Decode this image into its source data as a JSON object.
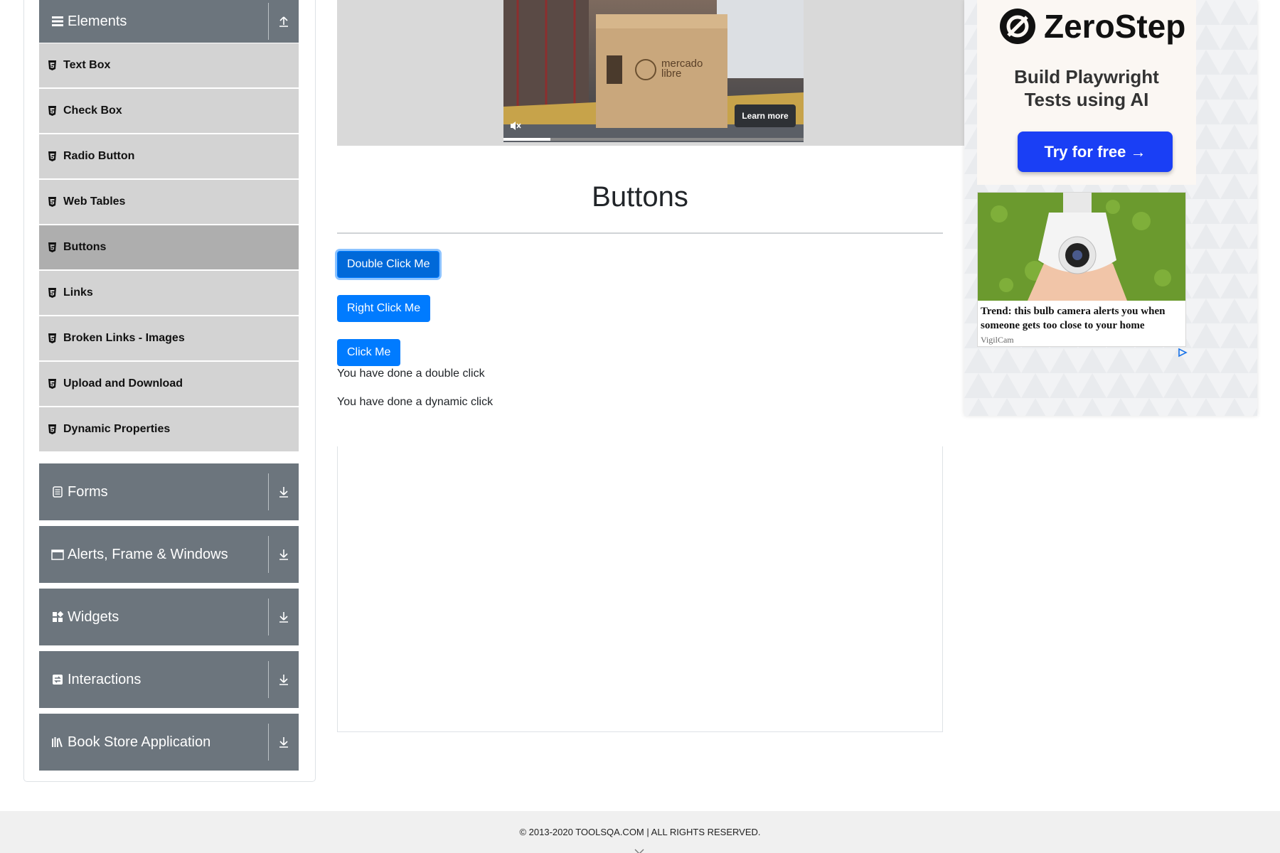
{
  "sidebar": {
    "groups": [
      {
        "title": "Elements",
        "icon": "bars-icon",
        "arrow": "collapse-up-icon"
      },
      {
        "title": "Forms",
        "icon": "form-icon",
        "arrow": "expand-down-icon"
      },
      {
        "title": "Alerts, Frame & Windows",
        "icon": "window-icon",
        "arrow": "expand-down-icon"
      },
      {
        "title": "Widgets",
        "icon": "widgets-icon",
        "arrow": "expand-down-icon"
      },
      {
        "title": "Interactions",
        "icon": "interactions-icon",
        "arrow": "expand-down-icon"
      },
      {
        "title": "Book Store Application",
        "icon": "books-icon",
        "arrow": "expand-down-icon"
      }
    ],
    "items": [
      {
        "label": "Text Box"
      },
      {
        "label": "Check Box"
      },
      {
        "label": "Radio Button"
      },
      {
        "label": "Web Tables"
      },
      {
        "label": "Buttons",
        "active": true
      },
      {
        "label": "Links"
      },
      {
        "label": "Broken Links - Images"
      },
      {
        "label": "Upload and Download"
      },
      {
        "label": "Dynamic Properties"
      }
    ]
  },
  "ad_top": {
    "box_text": "mercado libre",
    "learn_more": "Learn more"
  },
  "main": {
    "title": "Buttons",
    "double_click_label": "Double Click Me",
    "right_click_label": "Right Click Me",
    "click_label": "Click Me",
    "double_click_message": "You have done a double click",
    "dynamic_click_message": "You have done a dynamic click"
  },
  "ad_right": {
    "brand": "ZeroStep",
    "tagline_line1": "Build Playwright",
    "tagline_line2": "Tests using AI",
    "cta": "Try for free →",
    "article_title": "Trend: this bulb camera alerts you when someone gets too close to your home",
    "article_source": "VigilCam"
  },
  "footer": {
    "copyright": "© 2013-2020 TOOLSQA.COM | ALL RIGHTS RESERVED."
  },
  "colors": {
    "primary": "#007bff",
    "sidebar_header": "#6c757d",
    "sidebar_item": "#d3d3d3",
    "sidebar_item_active": "#aeaeae",
    "cta_blue": "#1a3ff5"
  }
}
